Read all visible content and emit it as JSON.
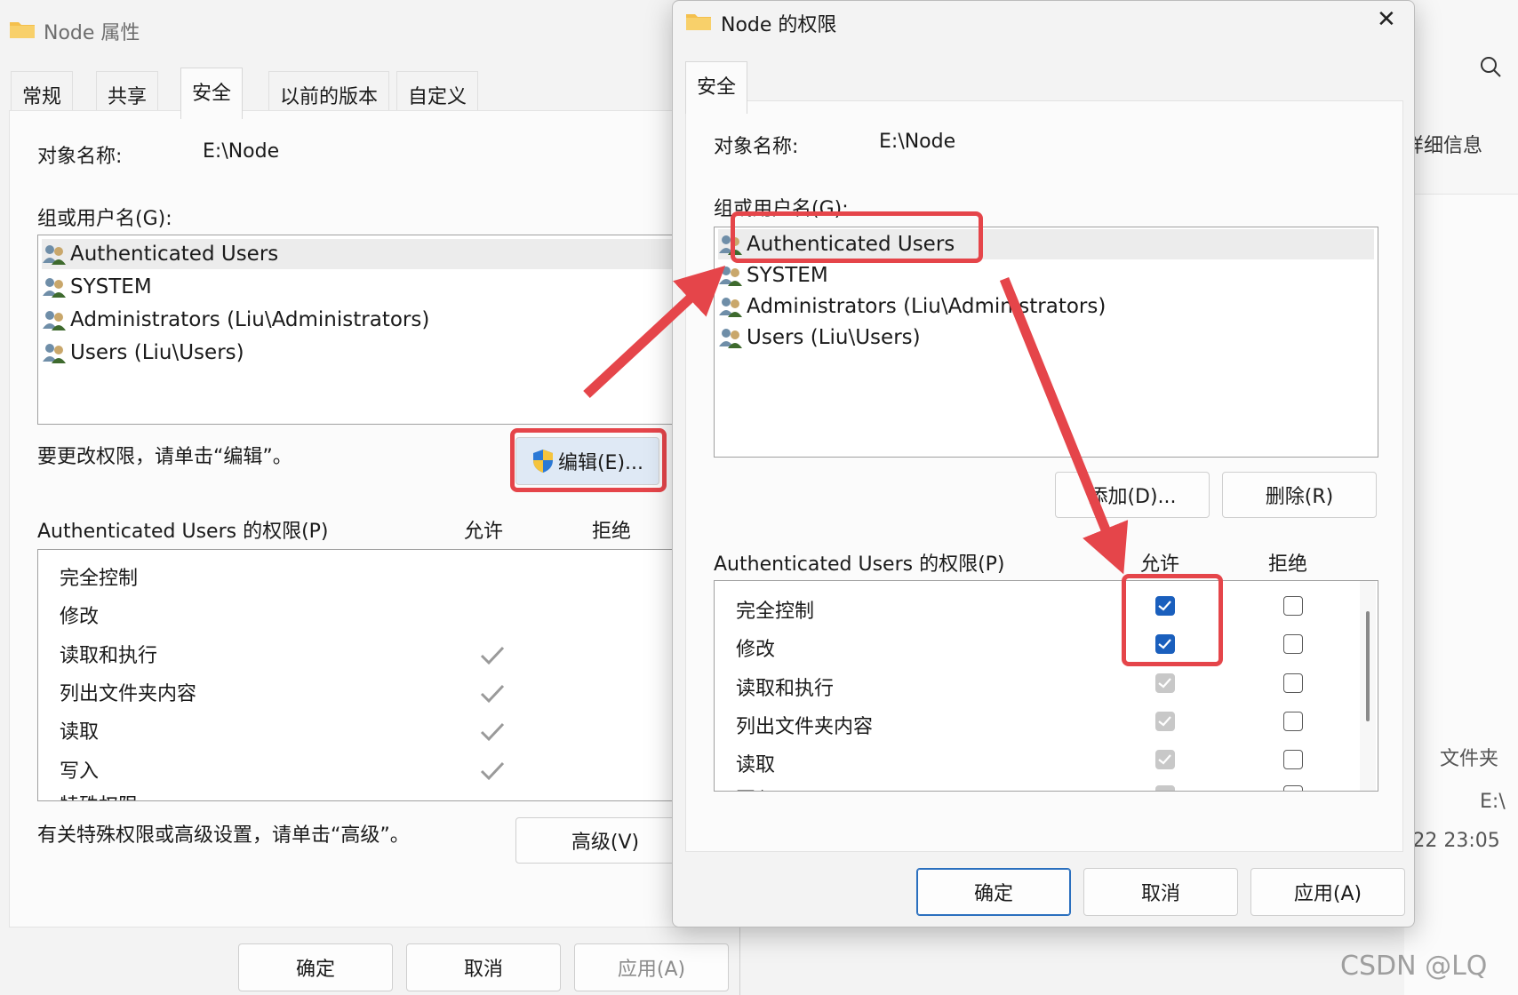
{
  "background": {
    "details_label": "详细信息",
    "type_value": "文件夹",
    "location_value": "E:\\",
    "date_value": "/22 23:05"
  },
  "props": {
    "title": "Node 属性",
    "tabs": [
      "常规",
      "共享",
      "安全",
      "以前的版本",
      "自定义"
    ],
    "object_name_label": "对象名称:",
    "object_name_value": "E:\\Node",
    "group_label": "组或用户名(G):",
    "users": [
      "Authenticated Users",
      "SYSTEM",
      "Administrators (Liu\\Administrators)",
      "Users (Liu\\Users)"
    ],
    "edit_hint": "要更改权限，请单击“编辑”。",
    "edit_button": "编辑(E)...",
    "perm_label": "Authenticated Users 的权限(P)",
    "allow_header": "允许",
    "deny_header": "拒绝",
    "permissions": [
      "完全控制",
      "修改",
      "读取和执行",
      "列出文件夹内容",
      "读取",
      "写入",
      "特殊权限"
    ],
    "advanced_hint": "有关特殊权限或高级设置，请单击“高级”。",
    "advanced_button": "高级(V)",
    "ok": "确定",
    "cancel": "取消",
    "apply": "应用(A)"
  },
  "perm_dialog": {
    "title": "Node 的权限",
    "close_glyph": "✕",
    "tab": "安全",
    "object_name_label": "对象名称:",
    "object_name_value": "E:\\Node",
    "group_label": "组或用户名(G):",
    "users": [
      "Authenticated Users",
      "SYSTEM",
      "Administrators (Liu\\Administrators)",
      "Users (Liu\\Users)"
    ],
    "add_button": "添加(D)...",
    "remove_button": "删除(R)",
    "perm_label": "Authenticated Users 的权限(P)",
    "allow_header": "允许",
    "deny_header": "拒绝",
    "permissions": [
      "完全控制",
      "修改",
      "读取和执行",
      "列出文件夹内容",
      "读取",
      "写入"
    ],
    "allow_states": [
      "checked",
      "checked",
      "inherited",
      "inherited",
      "inherited",
      "inherited"
    ],
    "deny_states": [
      "empty",
      "empty",
      "empty",
      "empty",
      "empty",
      "empty"
    ],
    "ok": "确定",
    "cancel": "取消",
    "apply": "应用(A)"
  },
  "watermark": "CSDN @LQ",
  "colors": {
    "annotation_red": "#e5454a",
    "check_blue": "#1a5fbd"
  }
}
